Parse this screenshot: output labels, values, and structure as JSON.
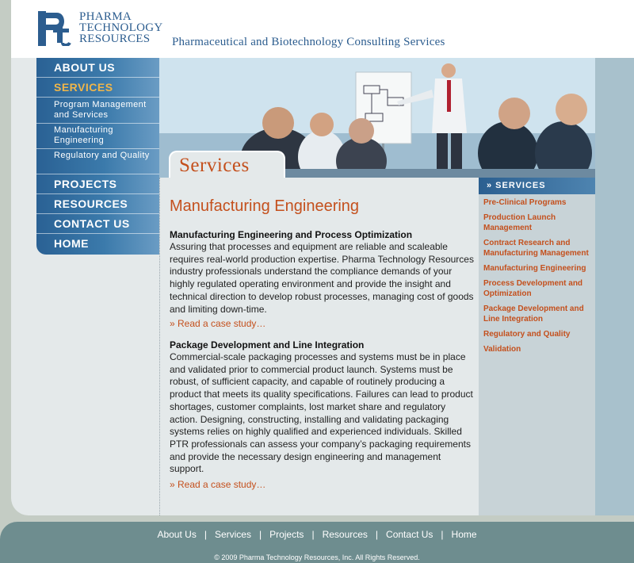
{
  "brand": {
    "logo_line1": "PHARMA",
    "logo_line2": "TECHNOLOGY",
    "logo_line3": "RESOURCES",
    "tagline": "Pharmaceutical and Biotechnology Consulting Services",
    "logo_letters": "PTR",
    "primary_color": "#2c5d8f",
    "accent_color": "#c4501d"
  },
  "nav": {
    "about": "ABOUT US",
    "services": "SERVICES",
    "sub1": "Program Management and Services",
    "sub2": "Manufacturing Engineering",
    "sub3": "Regulatory and Quality",
    "projects": "PROJECTS",
    "resources": "RESOURCES",
    "contact": "CONTACT US",
    "home": "HOME"
  },
  "hero": {
    "tab_label": "Services"
  },
  "main": {
    "title": "Manufacturing Engineering",
    "sections": [
      {
        "heading": "Manufacturing Engineering and Process Optimization",
        "body": "Assuring that processes and equipment are reliable and scaleable requires real-world production expertise. Pharma Technology Resources industry professionals understand the compliance demands of your highly regulated operating environment and provide the insight and technical direction to develop robust processes, managing cost of goods and limiting down-time.",
        "link": "» Read a case study…"
      },
      {
        "heading": "Package Development and Line Integration",
        "body": "Commercial-scale packaging processes and systems must be in place and validated prior to commercial product launch. Systems must be robust, of sufficient capacity, and capable of routinely producing a product that meets its quality specifications. Failures can lead to product shortages, customer complaints, lost market share and regulatory action. Designing, constructing, installing and validating packaging systems relies on highly qualified and experienced individuals. Skilled PTR professionals can assess your company’s packaging requirements and provide the necessary design engineering and management support.",
        "link": "» Read a case study…"
      }
    ]
  },
  "sidebar": {
    "heading": "» SERVICES",
    "links": [
      "Pre-Clinical Programs",
      "Production Launch Management",
      "Contract Research and Manufacturing Management",
      "Manufacturing Engineering",
      "Process Development and Optimization",
      "Package Development and Line Integration",
      "Regulatory and Quality",
      "Validation"
    ]
  },
  "footer": {
    "links": [
      "About Us",
      "Services",
      "Projects",
      "Resources",
      "Contact Us",
      "Home"
    ],
    "separator": "|",
    "copyright": "© 2009 Pharma Technology Resources, Inc. All Rights Reserved."
  }
}
